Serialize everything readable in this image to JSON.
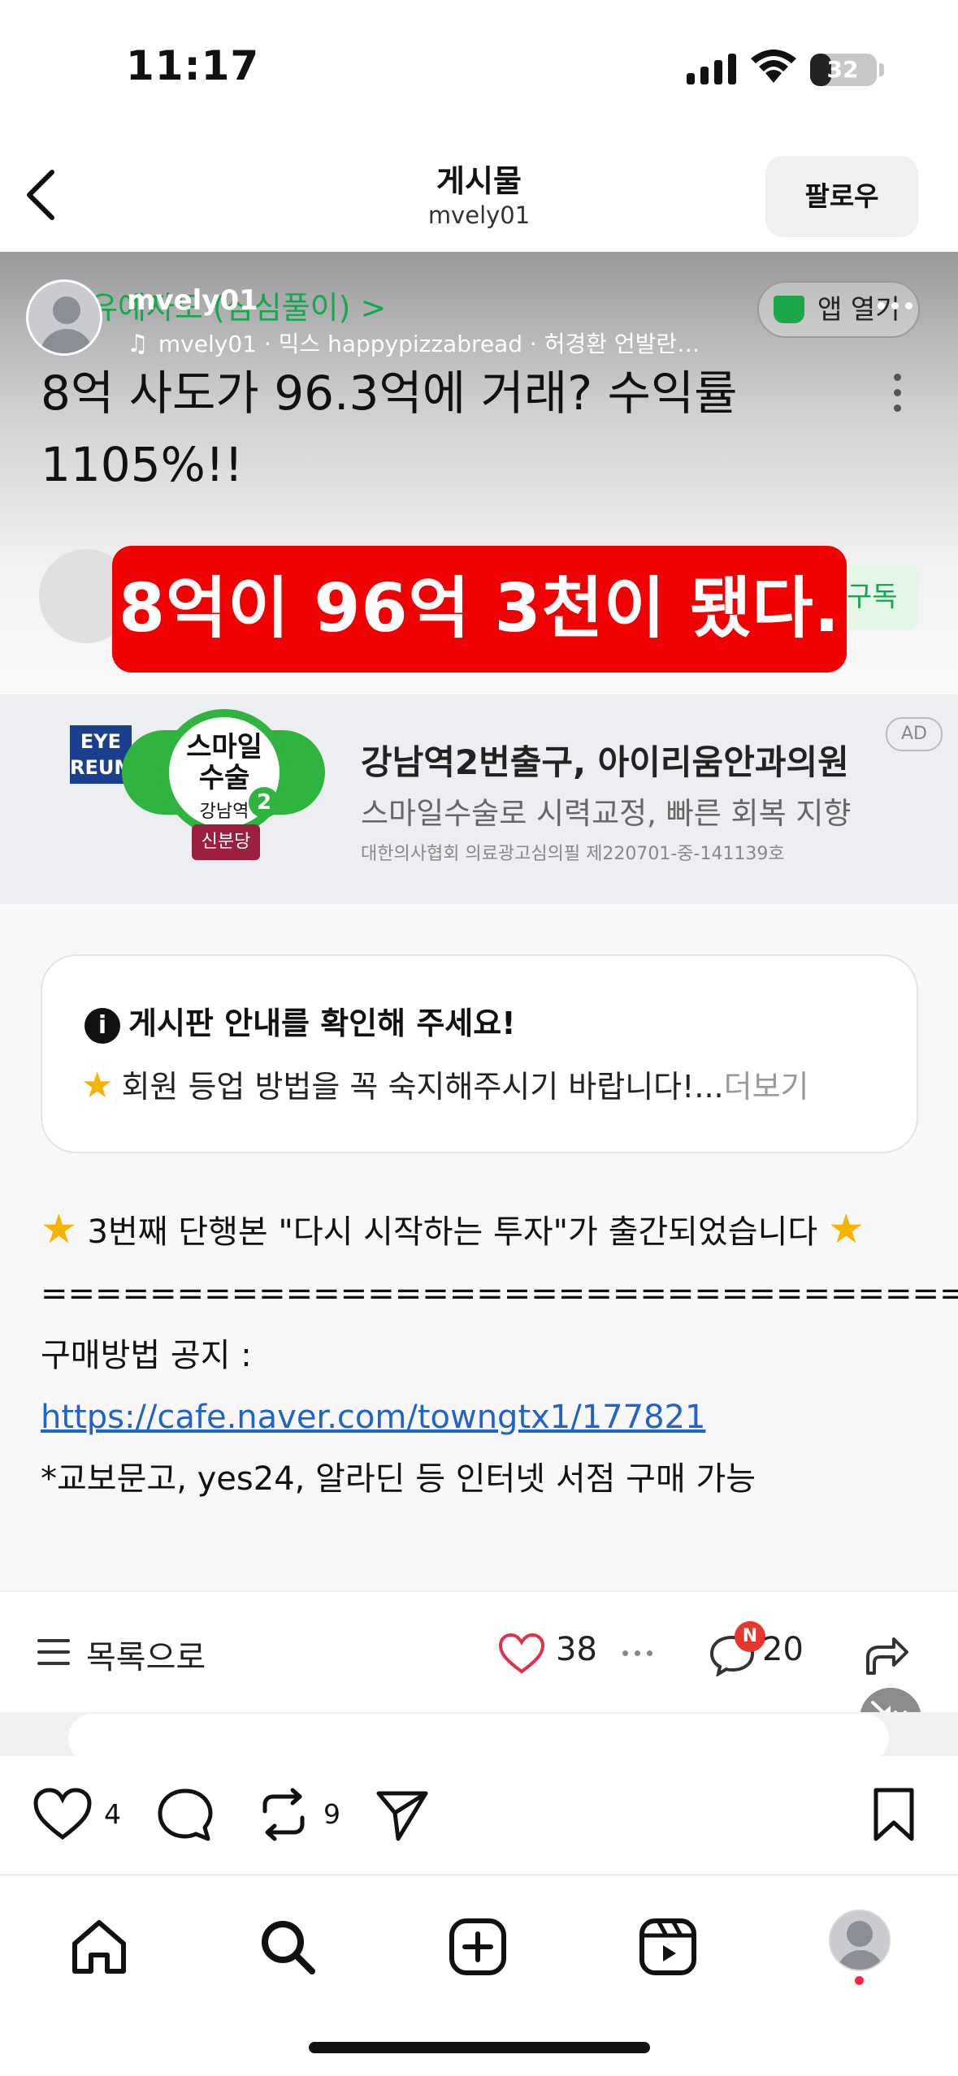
{
  "status_bar": {
    "time": "11:17",
    "battery": "32",
    "battery_level_percent": 32
  },
  "header": {
    "title": "게시물",
    "username": "mvely01",
    "follow_label": "팔로우"
  },
  "post": {
    "overlay_username": "mvely01",
    "audio_info": "mvely01 · 믹스  happypizzabread · 허경환 언발란…",
    "cafe_name": "유예자도 (심심풀이) >",
    "app_open_label": "앱 열기",
    "title": "8억 사도가 96.3억에 거래? 수익률 1105%!!",
    "subscribe_label": "구독",
    "caption": "8억이 96억 3천이 됐다.",
    "ad": {
      "logo_line1": "EYE",
      "logo_line2": "REUM",
      "badge_line1": "스마일",
      "badge_line2": "수술",
      "badge_line3": "강남역",
      "badge_number": "2",
      "badge_ribbon": "신분당",
      "title": "강남역2번출구, 아이리움안과의원",
      "subtitle": "스마일수술로 시력교정, 빠른 회복 지향",
      "fine_print": "대한의사협회 의료광고심의필 제220701-중-141139호",
      "ad_label": "AD"
    },
    "notice": {
      "icon_text": "i",
      "title": "게시판 안내를 확인해 주세요!",
      "text": "회원 등업 방법을 꼭 숙지해주시기 바랍니다!...",
      "more_label": "더보기"
    },
    "body": {
      "line1": "3번째 단행본 \"다시 시작하는 투자\"가 출간되었습니다",
      "separator": "==================================",
      "purchase_label": "구매방법 공지 : ",
      "purchase_link": "https://cafe.naver.com/towngtx1/177821",
      "line3": "*교보문고, yes24, 알라딘 등 인터넷 서점 구매 가능"
    },
    "footer": {
      "list_label": "목록으로",
      "like_count": "38",
      "comment_badge": "N",
      "comment_count": "20"
    }
  },
  "actions": {
    "like_count": "4",
    "repost_count": "9"
  },
  "colors": {
    "caption_red": "#f00000",
    "naver_green": "#14a84c",
    "link_blue": "#2263c9",
    "notification_red": "#ff2145"
  }
}
